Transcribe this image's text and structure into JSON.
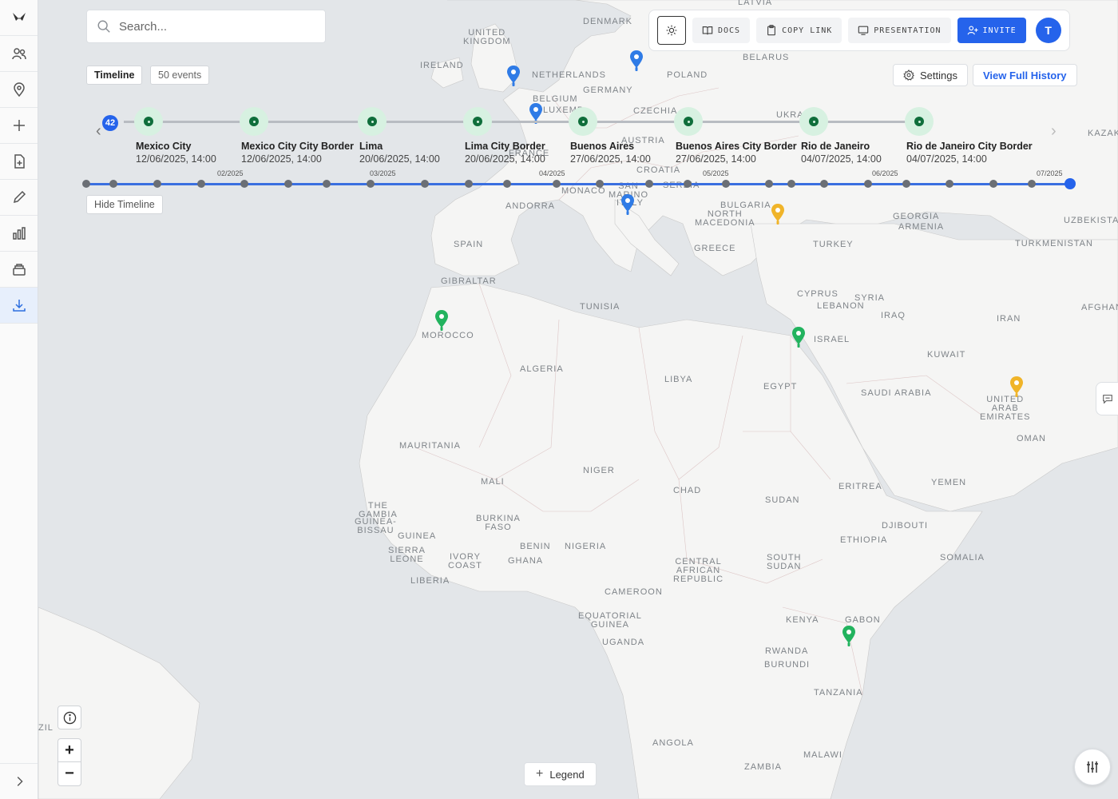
{
  "search": {
    "placeholder": "Search..."
  },
  "toolbar": {
    "docs_label": "DOCS",
    "copy_link_label": "COPY LINK",
    "presentation_label": "PRESENTATION",
    "invite_label": "INVITE",
    "avatar_initial": "T",
    "accent_color": "#2563eb"
  },
  "timeline_controls": {
    "timeline_label": "Timeline",
    "events_label": "50 events",
    "hide_label": "Hide Timeline",
    "badge_count": "42"
  },
  "header_actions": {
    "settings_label": "Settings",
    "history_label": "View Full History"
  },
  "events": [
    {
      "title": "Mexico City",
      "date": "12/06/2025, 14:00"
    },
    {
      "title": "Mexico City City Border",
      "date": "12/06/2025, 14:00"
    },
    {
      "title": "Lima",
      "date": "20/06/2025, 14:00"
    },
    {
      "title": "Lima City Border",
      "date": "20/06/2025, 14:00"
    },
    {
      "title": "Buenos Aires",
      "date": "27/06/2025, 14:00"
    },
    {
      "title": "Buenos Aires City Border",
      "date": "27/06/2025, 14:00"
    },
    {
      "title": "Rio de Janeiro",
      "date": "04/07/2025, 14:00"
    },
    {
      "title": "Rio de Janeiro City Border",
      "date": "04/07/2025, 14:00"
    }
  ],
  "months": [
    "02/2025",
    "03/2025",
    "04/2025",
    "05/2025",
    "06/2025",
    "07/2025"
  ],
  "map": {
    "countries": [
      "LATVIA",
      "DENMARK",
      "UNITED KINGDOM",
      "BELARUS",
      "IRELAND",
      "NETHERLANDS",
      "POLAND",
      "GERMANY",
      "BELGIUM",
      "LUXEMB",
      "CZECHIA",
      "UKRA",
      "FRANCE",
      "AUSTRIA",
      "KAZAK",
      "CROATIA",
      "SERBIA",
      "MONACO",
      "SAN MARINO",
      "ITALY",
      "ANDORRA",
      "BULGARIA",
      "NORTH MACEDONIA",
      "GEORGIA",
      "ARMENIA",
      "UZBEKISTA",
      "SPAIN",
      "TURKEY",
      "GREECE",
      "TURKMENISTAN",
      "GIBRALTAR",
      "TUNISIA",
      "CYPRUS",
      "SYRIA",
      "LEBANON",
      "AFGHAN",
      "MOROCCO",
      "IRAQ",
      "IRAN",
      "ISRAEL",
      "KUWAIT",
      "ALGERIA",
      "LIBYA",
      "EGYPT",
      "SAUDI ARABIA",
      "UNITED ARAB EMIRATES",
      "OMAN",
      "MAURITANIA",
      "MALI",
      "NIGER",
      "CHAD",
      "SUDAN",
      "ERITREA",
      "YEMEN",
      "THE GAMBIA",
      "GUINEA-BISSAU",
      "GUINEA",
      "BURKINA FASO",
      "BENIN",
      "NIGERIA",
      "DJIBOUTI",
      "ETHIOPIA",
      "SIERRA LEONE",
      "IVORY COAST",
      "GHANA",
      "CENTRAL AFRICAN REPUBLIC",
      "SOUTH SUDAN",
      "SOMALIA",
      "LIBERIA",
      "CAMEROON",
      "EQUATORIAL GUINEA",
      "UGANDA",
      "KENYA",
      "GABON",
      "RWANDA",
      "BURUNDI",
      "TANZANIA",
      "ZIL",
      "ANGOLA",
      "MALAWI",
      "ZAMBIA"
    ],
    "pin_colors": {
      "blue": "#2f7be6",
      "green": "#22b35e",
      "yellow": "#f0b429"
    }
  },
  "legend_label": "Legend"
}
